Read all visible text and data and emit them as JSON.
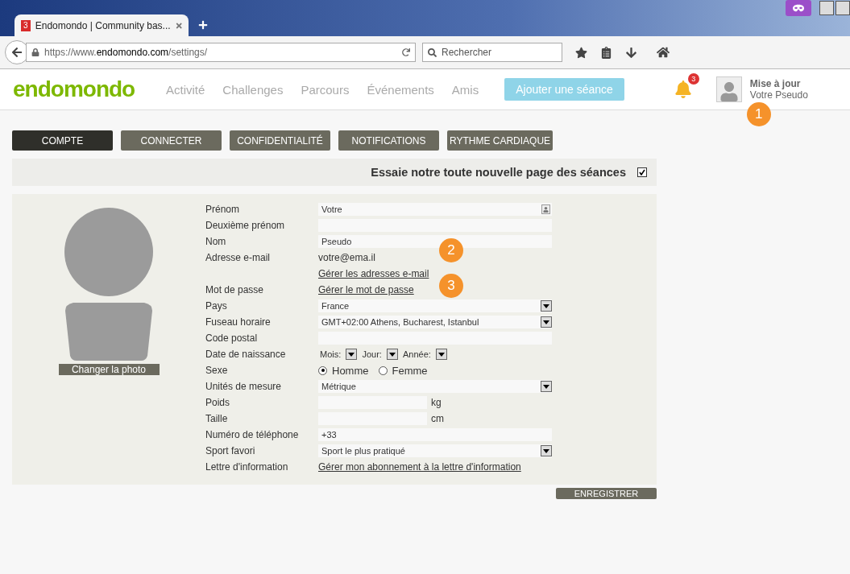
{
  "browser": {
    "tab_title": "Endomondo | Community bas...",
    "tab_badge": "3",
    "url_prefix": "https://www.",
    "url_domain": "endomondo.com",
    "url_path": "/settings/",
    "search_placeholder": "Rechercher"
  },
  "header": {
    "logo": "endomondo",
    "nav": [
      {
        "label": "Activité",
        "selected": false
      },
      {
        "label": "Challenges",
        "selected": false
      },
      {
        "label": "Parcours",
        "selected": false
      },
      {
        "label": "Événements",
        "selected": false
      },
      {
        "label": "Amis",
        "selected": false
      }
    ],
    "add_button": "Ajouter une séance",
    "notification_count": "3",
    "user": {
      "status": "Mise à jour",
      "name": "Votre Pseudo",
      "callout": "1"
    }
  },
  "tabs": [
    {
      "label": "COMPTE",
      "selected": true
    },
    {
      "label": "CONNECTER",
      "selected": false
    },
    {
      "label": "CONFIDENTIALITÉ",
      "selected": false
    },
    {
      "label": "NOTIFICATIONS",
      "selected": false
    },
    {
      "label": "RYTHME CARDIAQUE",
      "selected": false
    }
  ],
  "banner": {
    "text": "Essaie notre toute nouvelle page des séances",
    "checked": true
  },
  "photo_button": "Changer la photo",
  "fields": [
    {
      "kind": "input",
      "label": "Prénom",
      "value": "Votre",
      "contact_icon": true
    },
    {
      "kind": "input",
      "label": "Deuxième prénom"
    },
    {
      "kind": "input",
      "label": "Nom",
      "value": "Pseudo"
    },
    {
      "kind": "text",
      "label": "Adresse e-mail",
      "value": "votre@ema.il",
      "callout": "2"
    },
    {
      "kind": "link",
      "value": "Gérer les adresses e-mail"
    },
    {
      "kind": "link",
      "label": "Mot de passe",
      "value": "Gérer le mot de passe",
      "callout": "3"
    },
    {
      "kind": "select",
      "label": "Pays",
      "value": "France"
    },
    {
      "kind": "select",
      "label": "Fuseau horaire",
      "value": "GMT+02:00 Athens, Bucharest, Istanbul"
    },
    {
      "kind": "input",
      "label": "Code postal"
    },
    {
      "kind": "date",
      "label": "Date de naissance",
      "parts": [
        "Mois:",
        "Jour:",
        "Année:"
      ]
    },
    {
      "kind": "radio",
      "label": "Sexe",
      "options": [
        {
          "label": "Homme",
          "selected": true
        },
        {
          "label": "Femme",
          "selected": false
        }
      ]
    },
    {
      "kind": "select",
      "label": "Unités de mesure",
      "value": "Métrique"
    },
    {
      "kind": "unit",
      "label": "Poids",
      "unit": "kg"
    },
    {
      "kind": "unit",
      "label": "Taille",
      "unit": "cm"
    },
    {
      "kind": "input",
      "label": "Numéro de téléphone",
      "value": "+33"
    },
    {
      "kind": "select",
      "label": "Sport favori",
      "value": "Sport le plus pratiqué"
    },
    {
      "kind": "link",
      "label": "Lettre d'information",
      "value": "Gérer mon abonnement à la lettre d'information"
    }
  ],
  "save_button": "ENREGISTRER"
}
